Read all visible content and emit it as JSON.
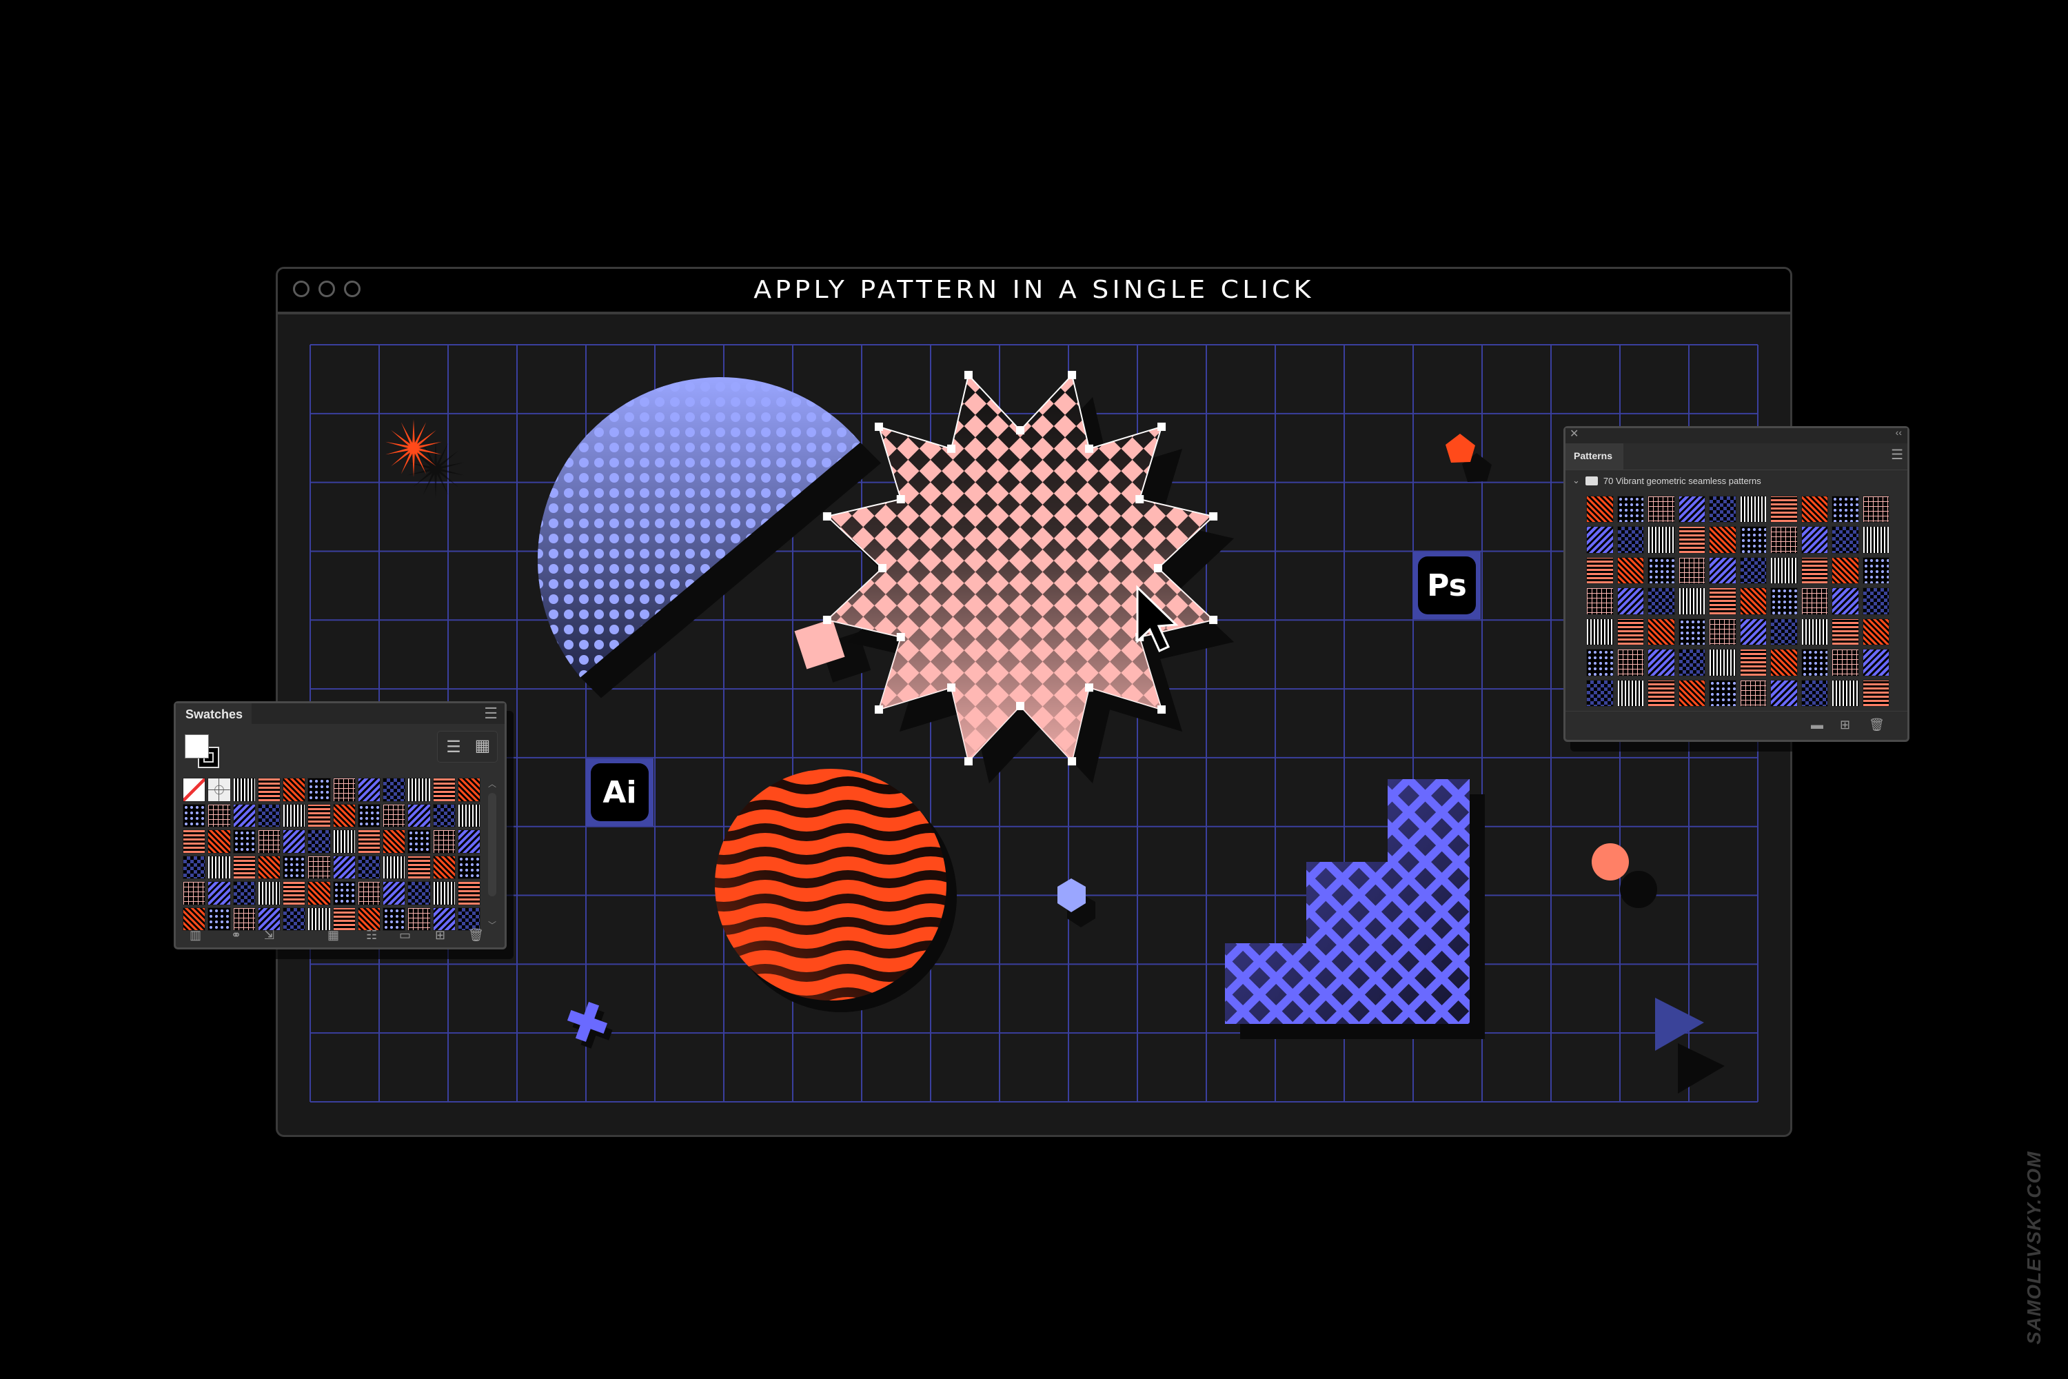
{
  "window": {
    "title": "APPLY PATTERN IN A SINGLE CLICK",
    "traffic_lights": [
      "close",
      "minimize",
      "zoom"
    ]
  },
  "colors": {
    "background": "#000000",
    "canvas": "#191919",
    "grid_line": "#3a3f9e",
    "coral": "#ff8066",
    "red_orange": "#ff4a1a",
    "pink": "#ffb8b4",
    "periwinkle": "#9aa6ff",
    "violet": "#6a6aff",
    "navy": "#3a4399",
    "panel_bg": "#2f2f2f",
    "panel_border": "#4a4a4a"
  },
  "canvas": {
    "grid": {
      "columns": 21,
      "rows": 11
    },
    "shapes": [
      {
        "name": "starburst",
        "color": "#ff4a1a"
      },
      {
        "name": "half-circle-dots",
        "color": "#9aa6ff",
        "pattern": "halftone-dots"
      },
      {
        "name": "tilted-square",
        "color": "#ffb8b4"
      },
      {
        "name": "twelve-point-star",
        "color": "#ffb8b4",
        "pattern": "zigzag-diamonds",
        "selected": true
      },
      {
        "name": "pentagon",
        "color": "#ff4a1a"
      },
      {
        "name": "wave-circle",
        "color": "#ff4a1a",
        "pattern": "waves"
      },
      {
        "name": "hexagon",
        "color": "#9aa6ff"
      },
      {
        "name": "stairs",
        "color": "#6a6aff",
        "pattern": "diamond-lattice"
      },
      {
        "name": "cross",
        "color": "#6a6aff"
      },
      {
        "name": "dot",
        "color": "#ff8066"
      },
      {
        "name": "triangle",
        "color": "#3a4399"
      }
    ],
    "app_badges": {
      "illustrator": "Ai",
      "photoshop": "Ps"
    }
  },
  "swatches_panel": {
    "tab_label": "Swatches",
    "menu_icon": "hamburger-menu-icon",
    "view_toggles": [
      "list-view-icon",
      "grid-view-icon"
    ],
    "fill_color": "#ffffff",
    "stroke_color": "#000000",
    "grid": {
      "columns": 12,
      "rows": 6
    },
    "special_swatches": [
      "None",
      "Registration"
    ],
    "footer_icons": [
      "libraries-icon",
      "color-group-icon",
      "import-icon",
      "show-kinds-icon",
      "swatch-options-icon",
      "new-group-folder-icon",
      "new-swatch-icon",
      "delete-icon"
    ]
  },
  "patterns_panel": {
    "tab_label": "Patterns",
    "close_icon": "close-icon",
    "collapse_icon": "collapse-icon",
    "menu_icon": "hamburger-menu-icon",
    "group_label": "70 Vibrant geometric seamless patterns",
    "pattern_count": 70,
    "grid": {
      "columns": 10,
      "rows": 7
    },
    "footer_icons": [
      "new-group-folder-icon",
      "new-pattern-icon",
      "delete-icon"
    ]
  },
  "watermark": "SAMOLEVSKY.COM"
}
